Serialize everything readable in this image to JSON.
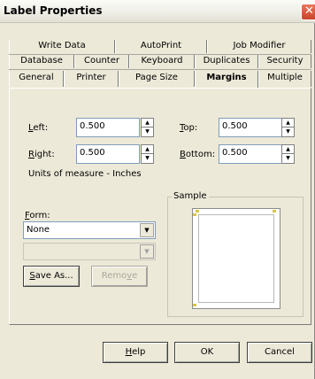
{
  "window": {
    "title": "Label Properties",
    "close_glyph": "✕"
  },
  "tabs": {
    "row1": [
      "Write Data",
      "AutoPrint",
      "Job Modifier"
    ],
    "row2": [
      "Database",
      "Counter",
      "Keyboard",
      "Duplicates",
      "Security"
    ],
    "row3": [
      "General",
      "Printer",
      "Page Size",
      "Margins",
      "Multiple"
    ],
    "active": "Margins"
  },
  "margins": {
    "left": {
      "hotkey": "L",
      "rest": "eft:",
      "value": "0.500"
    },
    "right": {
      "hotkey": "R",
      "rest": "ight:",
      "value": "0.500"
    },
    "top": {
      "hotkey": "T",
      "rest": "op:",
      "value": "0.500"
    },
    "bottom": {
      "hotkey": "B",
      "rest": "ottom:",
      "value": "0.500"
    },
    "units_text": "Units of measure - Inches"
  },
  "form": {
    "label_hotkey": "F",
    "label_rest": "orm:",
    "selected": "None",
    "secondary_selected": "",
    "save_as_hotkey": "S",
    "save_as_rest": "ave As...",
    "remove_pre": "Remo",
    "remove_hotkey": "v",
    "remove_post": "e"
  },
  "sample": {
    "legend": "Sample"
  },
  "footer": {
    "help_hotkey": "H",
    "help_rest": "elp",
    "ok_label": "OK",
    "cancel_label": "Cancel"
  },
  "icons": {
    "spin_up": "▲",
    "spin_down": "▼",
    "dropdown": "▼"
  }
}
